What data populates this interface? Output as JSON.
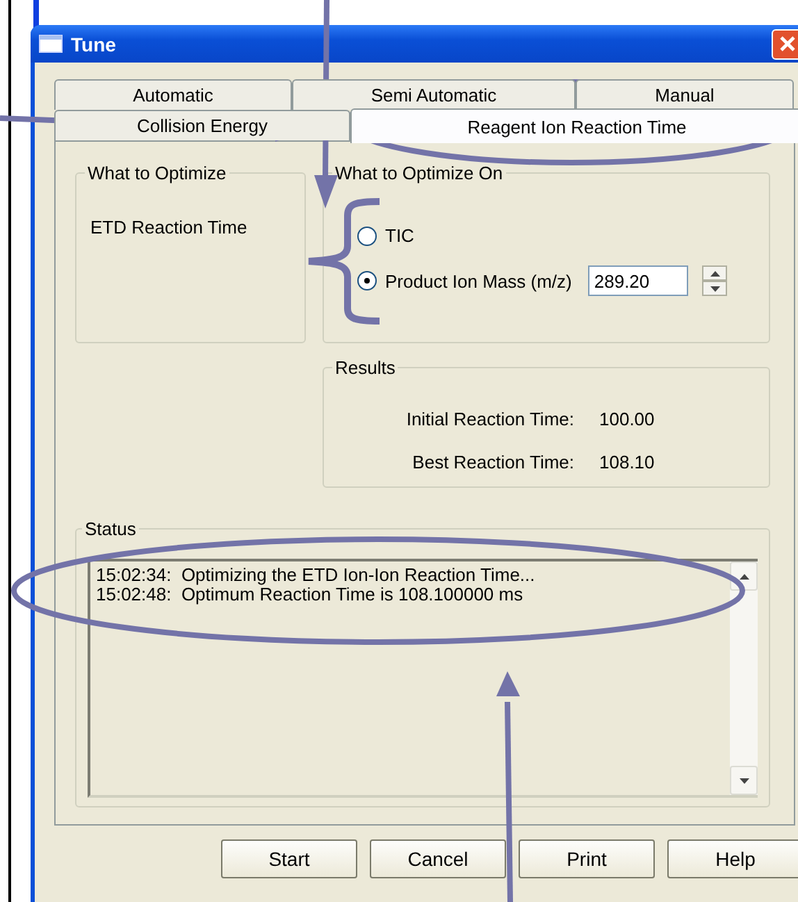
{
  "window": {
    "title": "Tune"
  },
  "tab_rows": [
    {
      "tabs": [
        {
          "label": "Automatic",
          "selected": false
        },
        {
          "label": "Semi Automatic",
          "selected": false
        },
        {
          "label": "Manual",
          "selected": false
        }
      ]
    },
    {
      "tabs": [
        {
          "label": "Collision Energy",
          "selected": false
        },
        {
          "label": "Reagent Ion Reaction Time",
          "selected": true
        }
      ]
    }
  ],
  "what_to_optimize": {
    "title": "What to Optimize",
    "value": "ETD Reaction Time"
  },
  "optimize_on": {
    "title": "What to Optimize On",
    "options": [
      {
        "label": "TIC",
        "selected": false
      },
      {
        "label": "Product Ion Mass (m/z)",
        "selected": true
      }
    ],
    "mass_value": "289.20"
  },
  "results": {
    "title": "Results",
    "rows": [
      {
        "label": "Initial Reaction Time:",
        "value": "100.00"
      },
      {
        "label": "Best Reaction Time:",
        "value": "108.10"
      }
    ]
  },
  "status": {
    "title": "Status",
    "lines": [
      "15:02:34:  Optimizing the ETD Ion-Ion Reaction Time...",
      "15:02:48:  Optimum Reaction Time is 108.100000 ms"
    ]
  },
  "buttons": [
    "Start",
    "Cancel",
    "Print",
    "Help"
  ]
}
